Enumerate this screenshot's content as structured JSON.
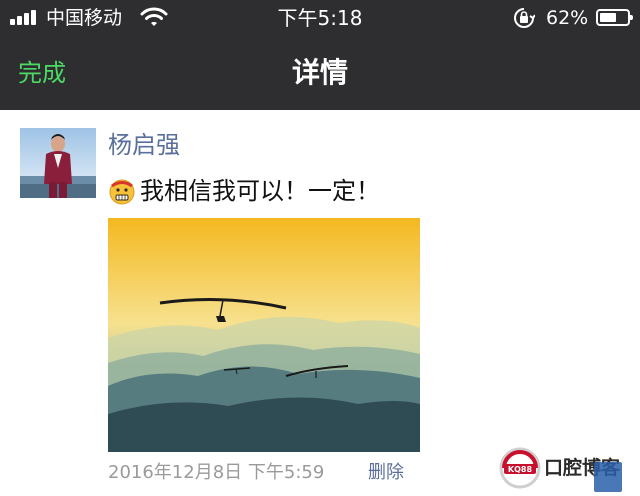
{
  "status_bar": {
    "carrier": "中国移动",
    "time": "下午5:18",
    "battery_percent": "62%",
    "battery_level": 0.62,
    "icons": [
      "signal-icon",
      "wifi-icon",
      "orientation-lock-icon",
      "battery-icon"
    ]
  },
  "nav": {
    "done_label": "完成",
    "title": "详情",
    "accent_color": "#4cd964",
    "background_color": "#2e2e30"
  },
  "post": {
    "author": "杨启强",
    "emoji": "grimacing-face-emoji",
    "text": "我相信我可以！一定！",
    "image": "hang-gliders-over-mountains-at-sunset",
    "timestamp": "2016年12月8日 下午5:59",
    "delete_label": "删除",
    "link_color": "#5a6f9b"
  },
  "watermark": {
    "badge": "KQ88",
    "text": "口腔博客"
  }
}
